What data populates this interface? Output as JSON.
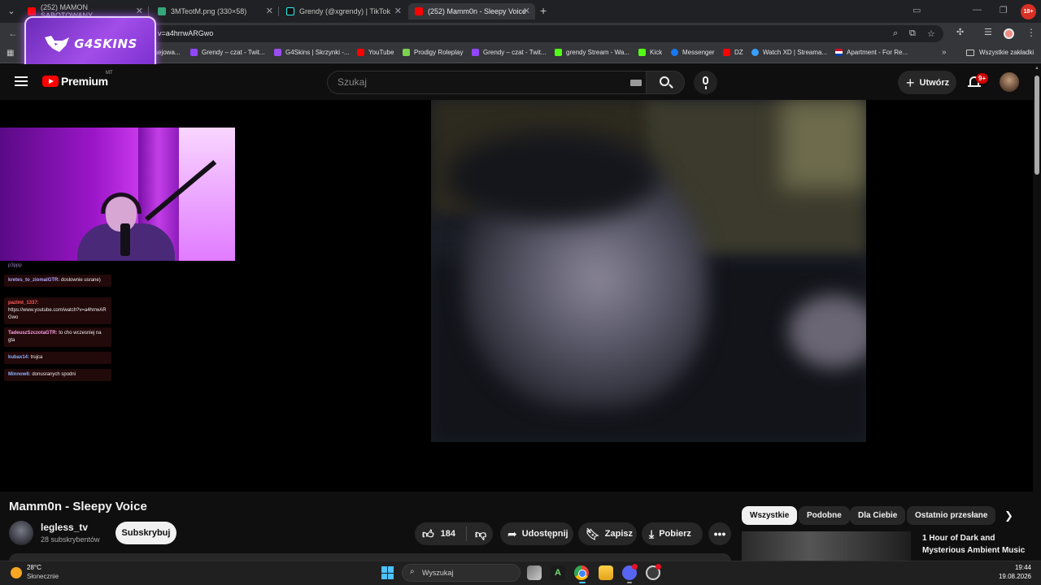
{
  "browser": {
    "tabs": [
      {
        "title": "(252) MAMON SABOTOWANY",
        "favicon_color": "#ff0000"
      },
      {
        "title": "3MTeotM.png (330×58)",
        "favicon_color": "#35a778"
      },
      {
        "title": "Grendy (@xgrendy) | TikTok",
        "favicon_color": "#111111"
      },
      {
        "title": "(252) Mamm0n - Sleepy Voice",
        "favicon_color": "#ff0000"
      }
    ],
    "url": "v=a4hrrwARGwo",
    "age_badge": "18+",
    "bookmarks": [
      {
        "label": "sejowa...",
        "color": "#9146ff"
      },
      {
        "label": "Grendy – czat - Twit...",
        "color": "#9146ff"
      },
      {
        "label": "G4Skins | Skrzynki -...",
        "color": "#9a4df0"
      },
      {
        "label": "YouTube",
        "color": "#ff0000"
      },
      {
        "label": "Prodigy Roleplay",
        "color": "#7bd34f"
      },
      {
        "label": "Grendy – czat - Twit...",
        "color": "#9146ff"
      },
      {
        "label": "grendy Stream - Wa...",
        "color": "#53fc18"
      },
      {
        "label": "Kick",
        "color": "#53fc18"
      },
      {
        "label": "Messenger",
        "color": "#1877f2"
      },
      {
        "label": "DZ",
        "color": "#ff0000"
      },
      {
        "label": "Watch XD | Streama...",
        "color": "#3aa0ff"
      },
      {
        "label": "Apartment - For Re...",
        "color": "#c8102e"
      }
    ],
    "all_bookmarks_label": "Wszystkie zakładki"
  },
  "overlay": {
    "logo_text": "G4SKINS"
  },
  "youtube": {
    "logo_text": "Premium",
    "region_code": "MT",
    "search_placeholder": "Szukaj",
    "create_label": "Utwórz",
    "notification_count": "9+"
  },
  "stream_chat": [
    {
      "user": "p3ppp",
      "text": "",
      "color": "#c77dff"
    },
    {
      "user": "kretes_to_ziomalGTR:",
      "text": "doslownie usrane)",
      "color": "#b0a8ff"
    },
    {
      "user": "pazlmt_1337:",
      "text": "https://www.youtube.com/watch?v=a4hrrwARGwo",
      "color": "#ff5c5c"
    },
    {
      "user": "TadeuszSzczotaGTR:",
      "text": "to cho wczesniej na gta",
      "color": "#ff9de2"
    },
    {
      "user": "kubax14:",
      "text": "trujca",
      "color": "#8ab4ff"
    },
    {
      "user": "Minnow6:",
      "text": "donusranych spodni",
      "color": "#8ab4ff"
    }
  ],
  "video": {
    "title": "Mamm0n - Sleepy Voice",
    "channel_name": "legless_tv",
    "subscribers": "28 subskrybentów",
    "subscribe_label": "Subskrybuj",
    "likes": "184",
    "share_label": "Udostępnij",
    "save_label": "Zapisz",
    "download_label": "Pobierz"
  },
  "recommendations": {
    "chips": [
      "Wszystkie",
      "Podobne",
      "Dla Ciebie",
      "Ostatnio przesłane"
    ],
    "first_title": "1 Hour of Dark and Mysterious Ambient Music"
  },
  "taskbar": {
    "temperature": "28°C",
    "weather": "Słonecznie",
    "search_placeholder": "Wyszukaj",
    "time": "19:44",
    "date": "19.08.2026"
  }
}
